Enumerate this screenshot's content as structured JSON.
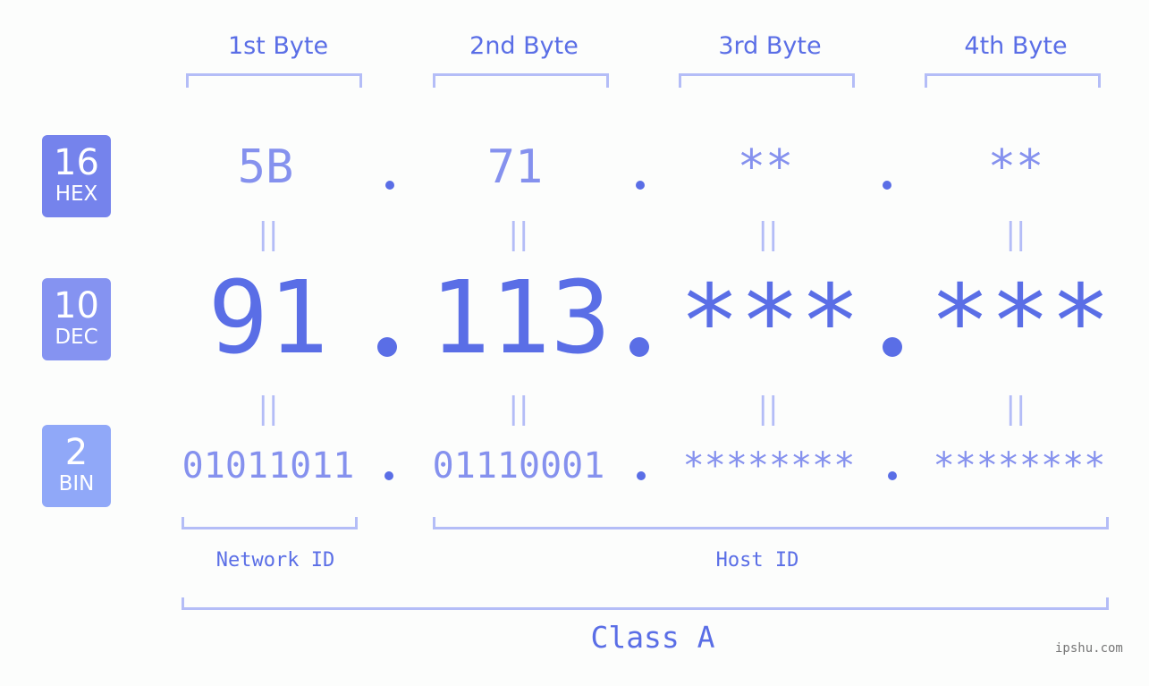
{
  "colors": {
    "hex_badge": "#7583ec",
    "dec_badge": "#8593f1",
    "bin_badge": "#90a8f8",
    "primary_text": "#5a6ee6",
    "secondary_text": "#8591ee",
    "bracket": "#b4bdf7",
    "background": "#fcfdfc"
  },
  "badges": [
    {
      "number": "16",
      "label": "HEX"
    },
    {
      "number": "10",
      "label": "DEC"
    },
    {
      "number": "2",
      "label": "BIN"
    }
  ],
  "byte_headers": [
    "1st Byte",
    "2nd Byte",
    "3rd Byte",
    "4th Byte"
  ],
  "hex_values": [
    "5B",
    "71",
    "**",
    "**"
  ],
  "dec_values": [
    "91",
    "113",
    "***",
    "***"
  ],
  "bin_values": [
    "01011011",
    "01110001",
    "********",
    "********"
  ],
  "equals_symbol": "||",
  "network_id_label": "Network ID",
  "host_id_label": "Host ID",
  "class_label": "Class A",
  "watermark": "ipshu.com"
}
